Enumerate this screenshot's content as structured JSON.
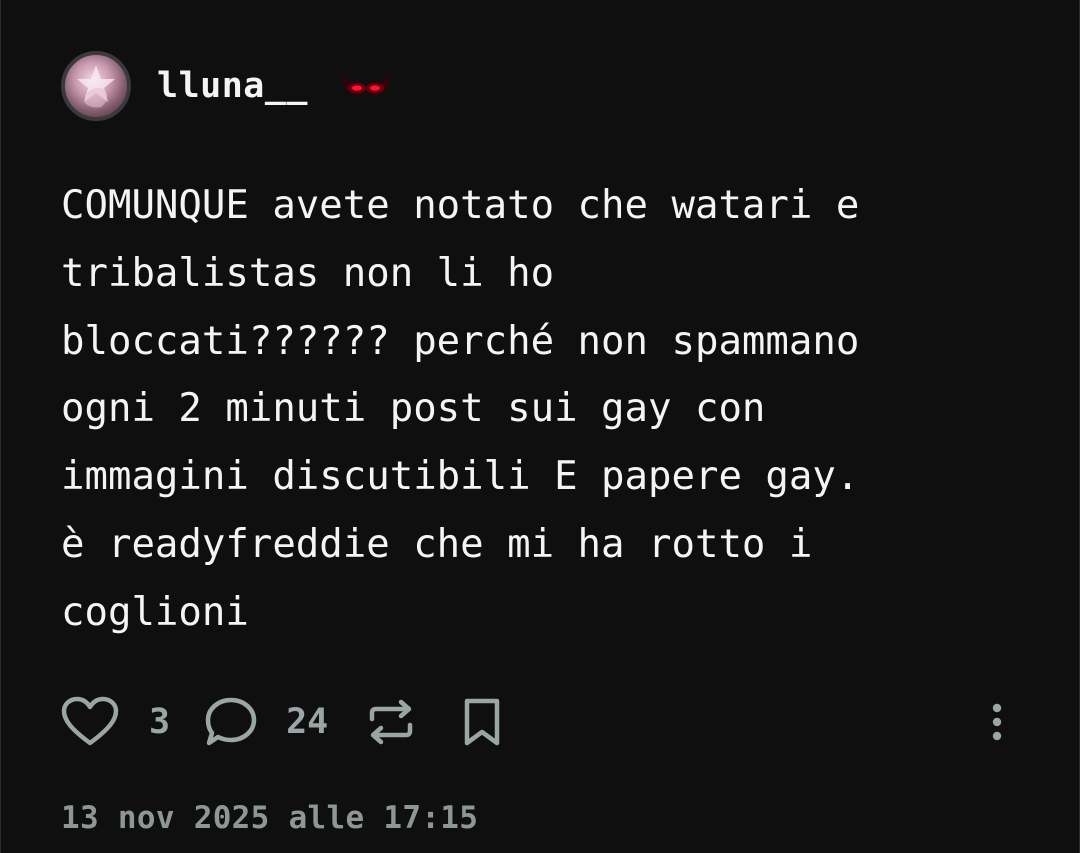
{
  "post": {
    "username": "lluna__",
    "text": "COMUNQUE avete notato che watari e\ntribalistas non li ho\nbloccati?????? perché non spammano\nogni 2 minuti post sui gay con\nimmagini discutibili E papere gay.\nè readyfreddie che mi ha rotto i\ncoglioni",
    "likes": "3",
    "comments": "24",
    "timestamp": "13 nov 2025 alle 17:15"
  },
  "icons": {
    "like": "heart-icon",
    "comment": "comment-bubble-icon",
    "repost": "repost-icon",
    "save": "bookmark-icon",
    "more": "more-vertical-icon",
    "badge": "red-eyes-badge-icon"
  },
  "colors": {
    "background": "#0f0f0f",
    "text": "#f4f4f4",
    "icon": "#9aa6a6",
    "badge": "#c0001a"
  }
}
